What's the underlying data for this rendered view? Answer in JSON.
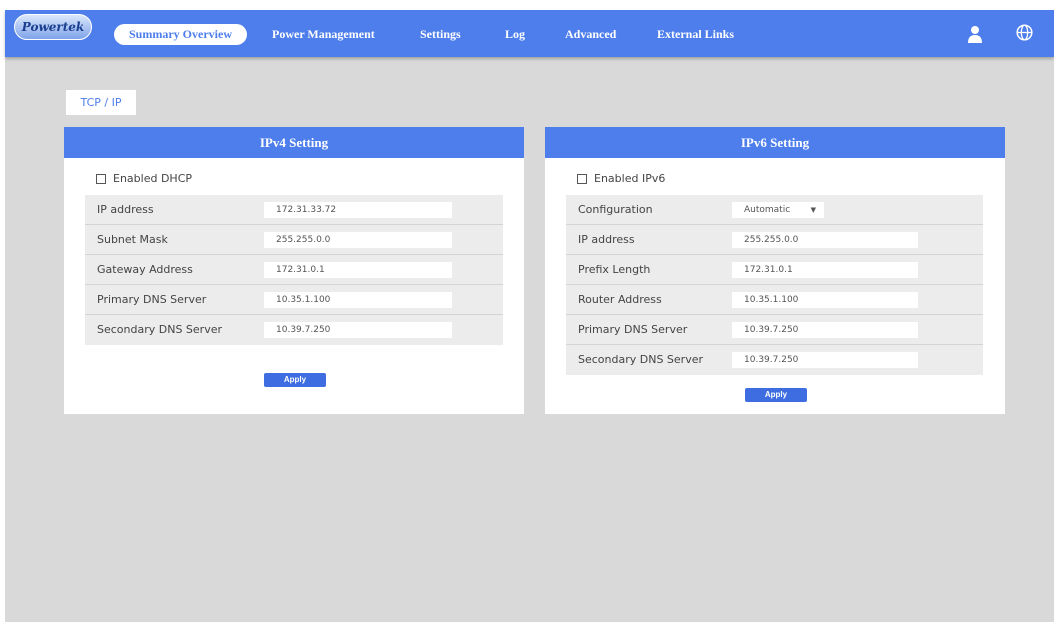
{
  "header": {
    "logo_text": "Powertek",
    "nav": [
      {
        "label": "Summary Overview",
        "active": true
      },
      {
        "label": "Power Management"
      },
      {
        "label": "Settings"
      },
      {
        "label": "Log"
      },
      {
        "label": "Advanced"
      },
      {
        "label": "External Links"
      }
    ],
    "icons": [
      "user-icon",
      "globe-icon"
    ]
  },
  "page": {
    "tab_label": "TCP / IP"
  },
  "ipv4": {
    "title": "IPv4 Setting",
    "checkbox_label": "Enabled DHCP",
    "checkbox_checked": false,
    "fields": [
      {
        "label": "IP address",
        "value": "172.31.33.72"
      },
      {
        "label": "Subnet Mask",
        "value": "255.255.0.0"
      },
      {
        "label": "Gateway Address",
        "value": "172.31.0.1"
      },
      {
        "label": "Primary DNS Server",
        "value": "10.35.1.100"
      },
      {
        "label": "Secondary DNS Server",
        "value": "10.39.7.250"
      }
    ],
    "apply_label": "Apply"
  },
  "ipv6": {
    "title": "IPv6 Setting",
    "checkbox_label": "Enabled IPv6",
    "checkbox_checked": false,
    "configuration": {
      "label": "Configuration",
      "value": "Automatic"
    },
    "fields": [
      {
        "label": "IP address",
        "value": "255.255.0.0"
      },
      {
        "label": "Prefix Length",
        "value": "172.31.0.1"
      },
      {
        "label": "Router Address",
        "value": "10.35.1.100"
      },
      {
        "label": "Primary DNS Server",
        "value": "10.39.7.250"
      },
      {
        "label": "Secondary DNS Server",
        "value": "10.39.7.250"
      }
    ],
    "apply_label": "Apply"
  },
  "colors": {
    "accent": "#4d7eec",
    "background": "#d9d9d9",
    "row_background": "#ececec"
  }
}
